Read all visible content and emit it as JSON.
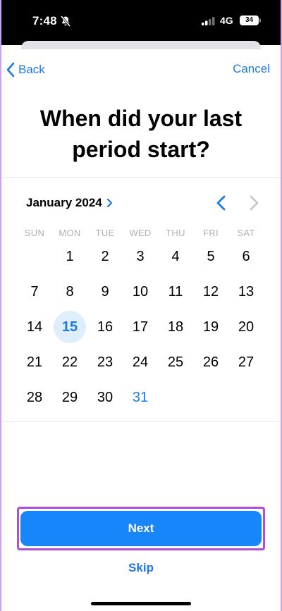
{
  "status": {
    "time": "7:48",
    "network": "4G",
    "battery": "34"
  },
  "nav": {
    "back_label": "Back",
    "cancel_label": "Cancel"
  },
  "title": "When did your last period start?",
  "calendar": {
    "month_label": "January 2024",
    "weekdays": [
      "SUN",
      "MON",
      "TUE",
      "WED",
      "THU",
      "FRI",
      "SAT"
    ],
    "first_weekday_index": 1,
    "days_in_month": 31,
    "selected_day": 15,
    "highlighted_day": 31
  },
  "actions": {
    "next_label": "Next",
    "skip_label": "Skip"
  },
  "colors": {
    "accent": "#1f7ae0",
    "button": "#1786fb",
    "selected_bg": "#dfeefc"
  }
}
